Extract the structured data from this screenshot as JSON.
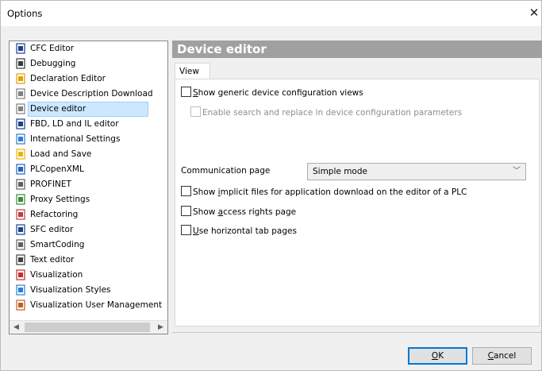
{
  "window": {
    "title": "Options",
    "close_glyph": "✕"
  },
  "tree": {
    "items": [
      {
        "label": "CFC Editor",
        "icon": "cfc-editor-icon",
        "color": "#1b3f8b"
      },
      {
        "label": "Debugging",
        "icon": "debugging-icon",
        "color": "#3a3a3a"
      },
      {
        "label": "Declaration Editor",
        "icon": "declaration-editor-icon",
        "color": "#e0a000"
      },
      {
        "label": "Device Description Download",
        "icon": "device-download-icon",
        "color": "#808080"
      },
      {
        "label": "Device editor",
        "icon": "device-editor-icon",
        "color": "#808080",
        "selected": true
      },
      {
        "label": "FBD, LD and IL editor",
        "icon": "fbd-editor-icon",
        "color": "#1b3f8b"
      },
      {
        "label": "International Settings",
        "icon": "globe-icon",
        "color": "#2a7fd4"
      },
      {
        "label": "Load and Save",
        "icon": "folder-icon",
        "color": "#e8b400"
      },
      {
        "label": "PLCopenXML",
        "icon": "plcopenxml-icon",
        "color": "#2060c0"
      },
      {
        "label": "PROFINET",
        "icon": "profinet-icon",
        "color": "#606060"
      },
      {
        "label": "Proxy Settings",
        "icon": "proxy-icon",
        "color": "#3a8a3a"
      },
      {
        "label": "Refactoring",
        "icon": "refactoring-icon",
        "color": "#c04040"
      },
      {
        "label": "SFC editor",
        "icon": "sfc-editor-icon",
        "color": "#1b3f8b"
      },
      {
        "label": "SmartCoding",
        "icon": "smartcoding-icon",
        "color": "#606060"
      },
      {
        "label": "Text editor",
        "icon": "text-editor-icon",
        "color": "#404040"
      },
      {
        "label": "Visualization",
        "icon": "visualization-icon",
        "color": "#c03030"
      },
      {
        "label": "Visualization Styles",
        "icon": "visualization-styles-icon",
        "color": "#2a7fd4"
      },
      {
        "label": "Visualization User Management",
        "icon": "user-management-icon",
        "color": "#c06020"
      }
    ]
  },
  "panel": {
    "header": "Device editor",
    "tab": "View",
    "options": {
      "generic_views": {
        "pre": "",
        "u": "S",
        "post": "how generic device configuration views",
        "checked": false
      },
      "search_replace": {
        "label": "Enable search and replace in device configuration parameters",
        "checked": false,
        "disabled": true
      },
      "implicit_files": {
        "pre": "Show ",
        "u": "i",
        "post": "mplicit files for application download on the editor of a PLC",
        "checked": false
      },
      "access_rights": {
        "pre": "Show ",
        "u": "a",
        "post": "ccess rights page",
        "checked": false
      },
      "horizontal_tabs": {
        "pre": "",
        "u": "U",
        "post": "se horizontal tab pages",
        "checked": false
      }
    },
    "communication": {
      "label": "Communication page",
      "value": "Simple mode"
    }
  },
  "buttons": {
    "ok": {
      "u": "O",
      "post": "K"
    },
    "cancel": {
      "u": "C",
      "post": "ancel"
    }
  },
  "colors": {
    "accent": "#0078d7",
    "header_bg": "#a0a0a0",
    "selection": "#cce8ff"
  }
}
